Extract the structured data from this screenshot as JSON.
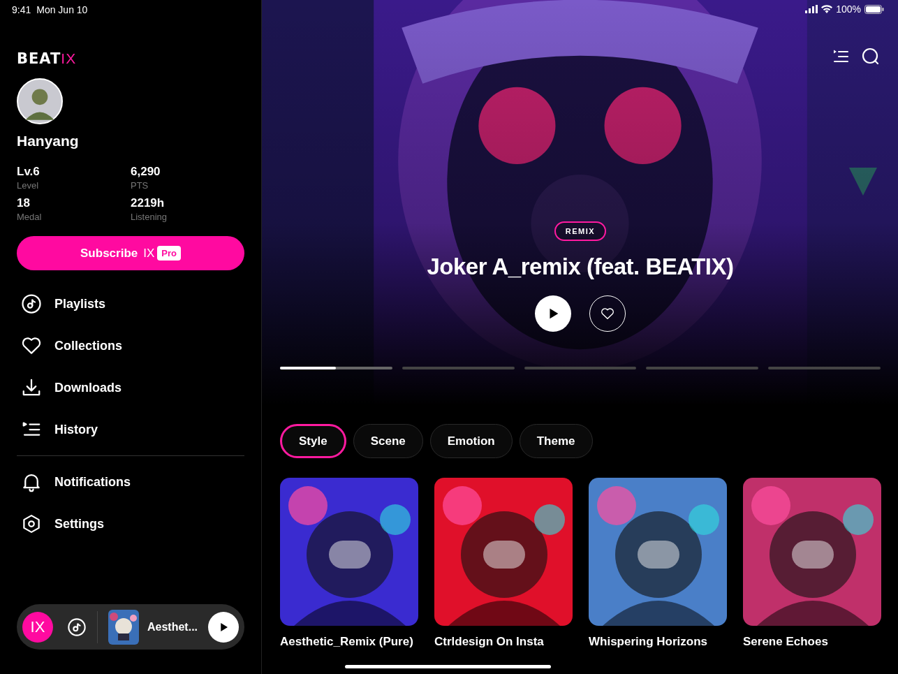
{
  "status_bar": {
    "time": "9:41",
    "date": "Mon Jun 10",
    "battery": "100%"
  },
  "logo": {
    "main": "BEAT",
    "accent": "IX"
  },
  "profile": {
    "name": "Hanyang",
    "stats": [
      {
        "value": "Lv.6",
        "label": "Level"
      },
      {
        "value": "6,290",
        "label": "PTS"
      },
      {
        "value": "18",
        "label": "Medal"
      },
      {
        "value": "2219h",
        "label": "Listening"
      }
    ]
  },
  "subscribe_button": {
    "label": "Subscribe",
    "brand": "IX",
    "badge": "Pro"
  },
  "menu": [
    {
      "label": "Playlists"
    },
    {
      "label": "Collections"
    },
    {
      "label": "Downloads"
    },
    {
      "label": "History"
    }
  ],
  "menu_secondary": [
    {
      "label": "Notifications"
    },
    {
      "label": "Settings"
    }
  ],
  "mini_player": {
    "logo": "IX",
    "track": "Aesthet..."
  },
  "hero": {
    "tag": "REMIX",
    "title": "Joker A_remix (feat. BEATIX)",
    "slides": [
      {
        "selected": true,
        "level": 0.5
      },
      {
        "selected": false
      },
      {
        "selected": false
      },
      {
        "selected": false
      },
      {
        "selected": false
      }
    ]
  },
  "tabs": [
    {
      "label": "Style",
      "selected": true
    },
    {
      "label": "Scene",
      "selected": false
    },
    {
      "label": "Emotion",
      "selected": false
    },
    {
      "label": "Theme",
      "selected": false
    }
  ],
  "cards": [
    {
      "title": "Aesthetic_Remix (Pure)",
      "color": "#3a2bd0"
    },
    {
      "title": "Ctrldesign On Insta",
      "color": "#e0102a"
    },
    {
      "title": "Whispering Horizons",
      "color": "#4a7fc8"
    },
    {
      "title": "Serene Echoes",
      "color": "#c0306a"
    }
  ]
}
